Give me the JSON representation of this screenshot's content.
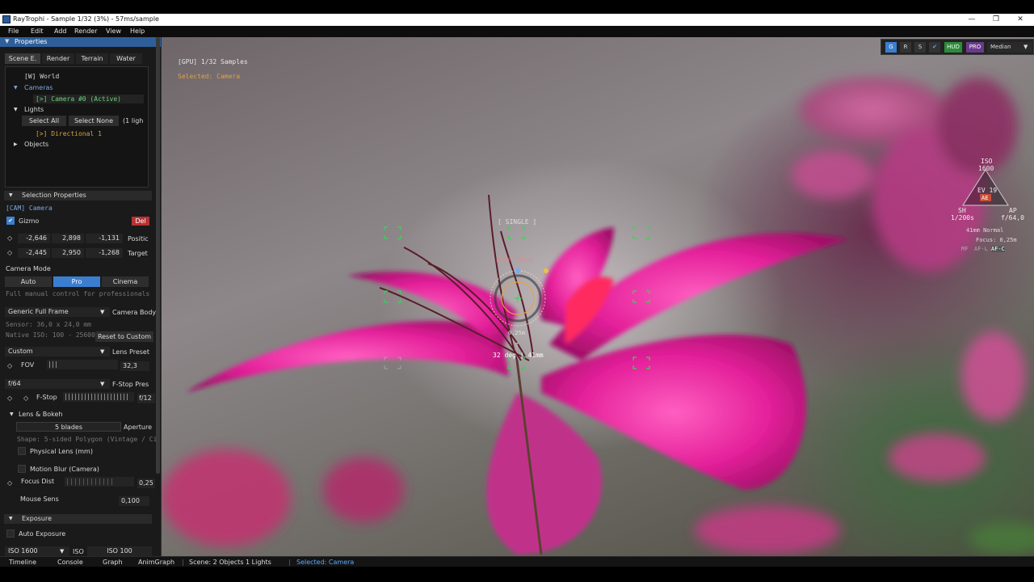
{
  "window": {
    "title": "RayTrophi - Sample 1/32 (3%) - 57ms/sample",
    "minimize": "—",
    "maximize": "❐",
    "close": "✕"
  },
  "menu": [
    "File",
    "Edit",
    "Add",
    "Render",
    "View",
    "Help"
  ],
  "panel": {
    "title": "Properties",
    "tabs": [
      "Scene E.",
      "Render",
      "Terrain",
      "Water"
    ],
    "tree": {
      "world": "[W] World",
      "cameras": "Cameras",
      "camera_item": "[>] Camera #0 (Active)",
      "lights": "Lights",
      "select_all": "Select All",
      "select_none": "Select None",
      "light_count": "(1 ligh",
      "light_item": "[>] Directional 1",
      "objects": "Objects"
    },
    "selection": {
      "header": "Selection Properties",
      "cam_label": "[CAM] Camera",
      "gizmo": "Gizmo",
      "del": "Del",
      "position": [
        "-2,646",
        "2,898",
        "-1,131"
      ],
      "position_label": "Positic",
      "target": [
        "-2,445",
        "2,950",
        "-1,268"
      ],
      "target_label": "Target"
    },
    "camera_mode": {
      "label": "Camera Mode",
      "modes": [
        "Auto",
        "Pro",
        "Cinema"
      ],
      "hint": "Full manual control for professionals"
    },
    "body": {
      "value": "Generic Full Frame",
      "label": "Camera Body",
      "sensor": "Sensor: 36,0 x 24,0 mm",
      "native_iso": "Native ISO: 100 - 25600",
      "reset": "Reset to Custom",
      "lens_value": "Custom",
      "lens_label": "Lens Preset",
      "fov_label": "FOV",
      "fov_value": "32,3",
      "fstop_preset": "f/64",
      "fstop_preset_label": "F-Stop Pres",
      "fstop_label": "F-Stop",
      "fstop_value": "f/12"
    },
    "lens_bokeh": {
      "header": "Lens & Bokeh",
      "blades_value": "5 blades",
      "aperture_label": "Aperture",
      "shape": "Shape: 5-sided Polygon (Vintage / Ci",
      "physical_lens": "Physical Lens (mm)",
      "motion_blur": "Motion Blur (Camera)",
      "focus_label": "Focus Dist",
      "focus_value": "0,25",
      "mouse_label": "Mouse Sens",
      "mouse_value": "0,100"
    },
    "exposure": {
      "header": "Exposure",
      "auto": "Auto Exposure",
      "iso_value": "ISO 1600",
      "iso_label": "ISO",
      "iso_min": "ISO 100"
    }
  },
  "viewport": {
    "samples": "[GPU] 1/32 Samples",
    "selected": "Selected: Camera",
    "single": "[ SINGLE ]",
    "front_focus": "FRONT FOCUS",
    "focus_dist": "0,25m",
    "t_marker": "T",
    "angle": "32 deg | 41mm"
  },
  "hud": {
    "buttons": [
      "G",
      "R",
      "S",
      "✔",
      "HUD",
      "PRO",
      "Median"
    ],
    "iso_label": "ISO",
    "iso_value": "1600",
    "ev": "EV 19",
    "ae": "AE",
    "sh_label": "SH",
    "sh_value": "1/200s",
    "ap_label": "AP",
    "ap_value": "f/64,0",
    "lens": "41mm Normal",
    "focus": "Focus: 0,25m",
    "mf": "MF",
    "af_l": "AF-L",
    "af_c": "AF-C"
  },
  "status": {
    "tabs": [
      "Timeline",
      "Console",
      "Graph",
      "AnimGraph"
    ],
    "scene": "Scene: 2 Objects 1 Lights",
    "selected": "Selected: Camera"
  },
  "colors": {
    "accent": "#3b7ed0",
    "highlight": "#d9a23a",
    "tree_green": "#6bcf7a",
    "focus_green": "#39d35a"
  }
}
